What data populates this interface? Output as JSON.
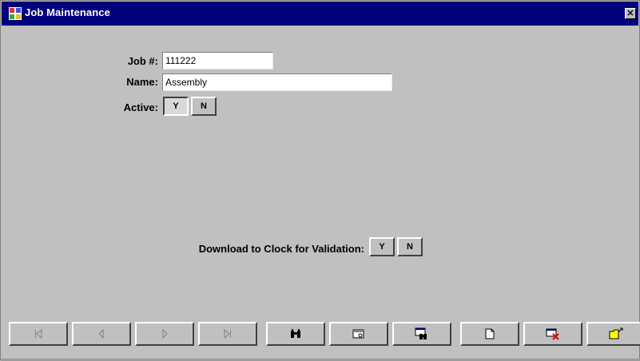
{
  "window": {
    "title": "Job Maintenance",
    "close_label": "✕"
  },
  "form": {
    "job_label": "Job #:",
    "job_value": "111222",
    "name_label": "Name:",
    "name_value": "Assembly",
    "active_label": "Active:",
    "active_yes": "Y",
    "active_no": "N",
    "active_selected": "Y",
    "download_label": "Download to Clock for Validation:",
    "download_yes": "Y",
    "download_no": "N"
  },
  "toolbar": {
    "buttons": [
      {
        "name": "first-record",
        "icon": "first-icon",
        "enabled": false
      },
      {
        "name": "previous-record",
        "icon": "previous-icon",
        "enabled": false
      },
      {
        "name": "next-record",
        "icon": "next-icon",
        "enabled": false
      },
      {
        "name": "last-record",
        "icon": "last-icon",
        "enabled": false
      },
      {
        "name": "find",
        "icon": "binoculars-icon",
        "enabled": true
      },
      {
        "name": "browse",
        "icon": "browse-icon",
        "enabled": true
      },
      {
        "name": "search-list",
        "icon": "search-list-icon",
        "enabled": true
      },
      {
        "name": "new",
        "icon": "new-document-icon",
        "enabled": true
      },
      {
        "name": "delete",
        "icon": "delete-icon",
        "enabled": true
      },
      {
        "name": "open",
        "icon": "open-folder-icon",
        "enabled": true
      }
    ]
  },
  "colors": {
    "titlebar": "#00007b",
    "face": "#c0c0c0",
    "disabled": "#808080"
  }
}
